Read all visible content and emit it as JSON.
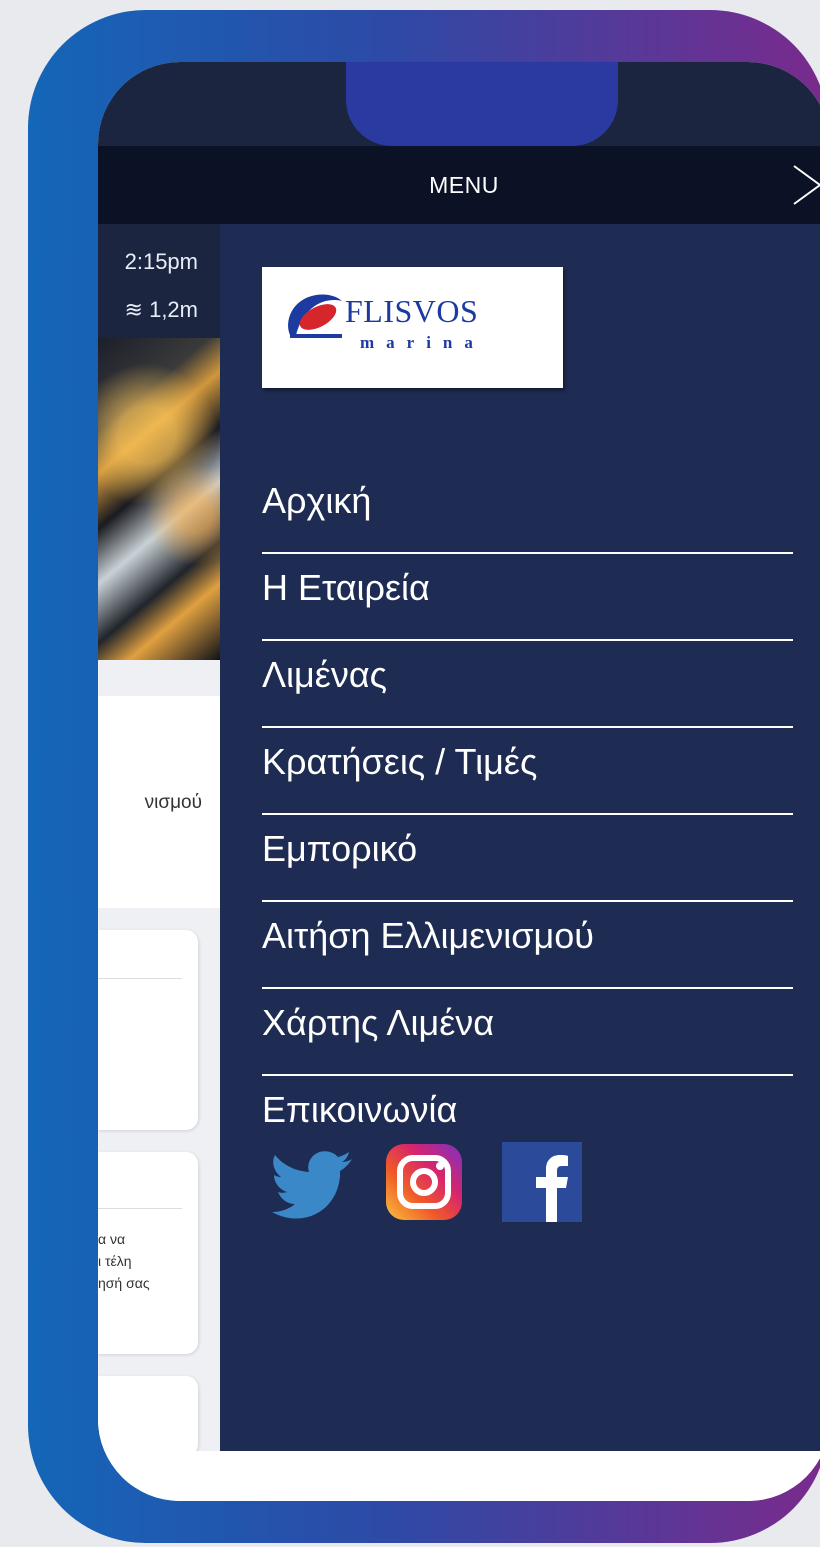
{
  "header": {
    "title": "MENU",
    "close_icon": "chevron-right-icon"
  },
  "background_page": {
    "time": "2:15pm",
    "wave_height": "1,2m",
    "snippet_1": "νισμού",
    "snippet_2": [
      "α να",
      "ι τέλη",
      "ησή σας"
    ]
  },
  "sidebar": {
    "logo": {
      "word": "FLISVOS",
      "sub": "marina"
    },
    "items": [
      {
        "label": "Αρχική"
      },
      {
        "label": "Η Εταιρεία"
      },
      {
        "label": "Λιμένας"
      },
      {
        "label": "Κρατήσεις / Τιμές"
      },
      {
        "label": "Εμπορικό"
      },
      {
        "label": "Αιτήση Ελλιμενισμού"
      },
      {
        "label": "Χάρτης Λιμένα"
      },
      {
        "label": "Επικοινωνία"
      }
    ],
    "social": [
      "twitter-icon",
      "instagram-icon",
      "facebook-icon"
    ]
  },
  "colors": {
    "frame_gradient": [
      "#1466b8",
      "#7a2a8c"
    ],
    "sidebar_bg": "#1e2b52",
    "menubar_bg": "#0b1226",
    "brand_blue": "#1d3aa0",
    "brand_red": "#d7252c"
  }
}
